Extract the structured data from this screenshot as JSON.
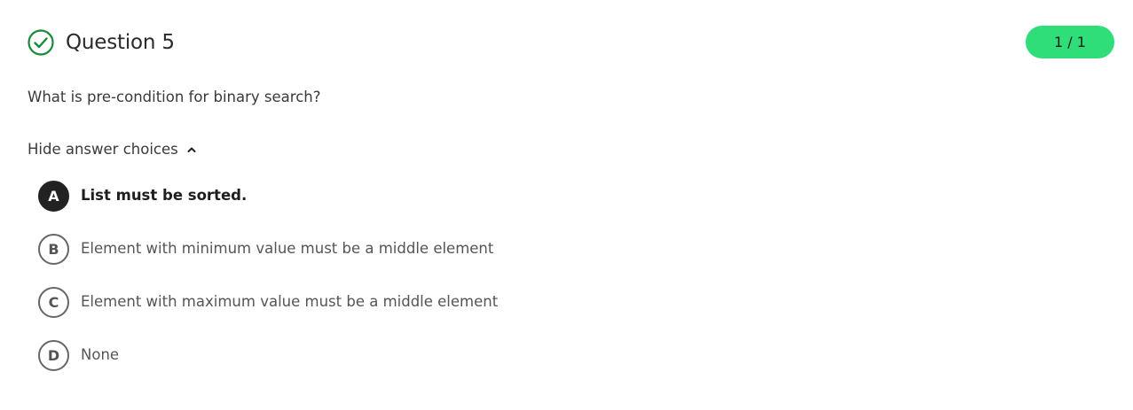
{
  "question": {
    "title": "Question 5",
    "score": "1 / 1",
    "prompt": "What is pre-condition for binary search?",
    "toggle_label": "Hide answer choices",
    "status_icon": "check-circle-icon",
    "accent_color": "#2fde79",
    "correct_icon_color": "#1a8a3a"
  },
  "choices": [
    {
      "letter": "A",
      "text": "List must be sorted.",
      "selected": true
    },
    {
      "letter": "B",
      "text": "Element with minimum value must be a middle element",
      "selected": false
    },
    {
      "letter": "C",
      "text": "Element with maximum value must be a middle element",
      "selected": false
    },
    {
      "letter": "D",
      "text": "None",
      "selected": false
    }
  ]
}
